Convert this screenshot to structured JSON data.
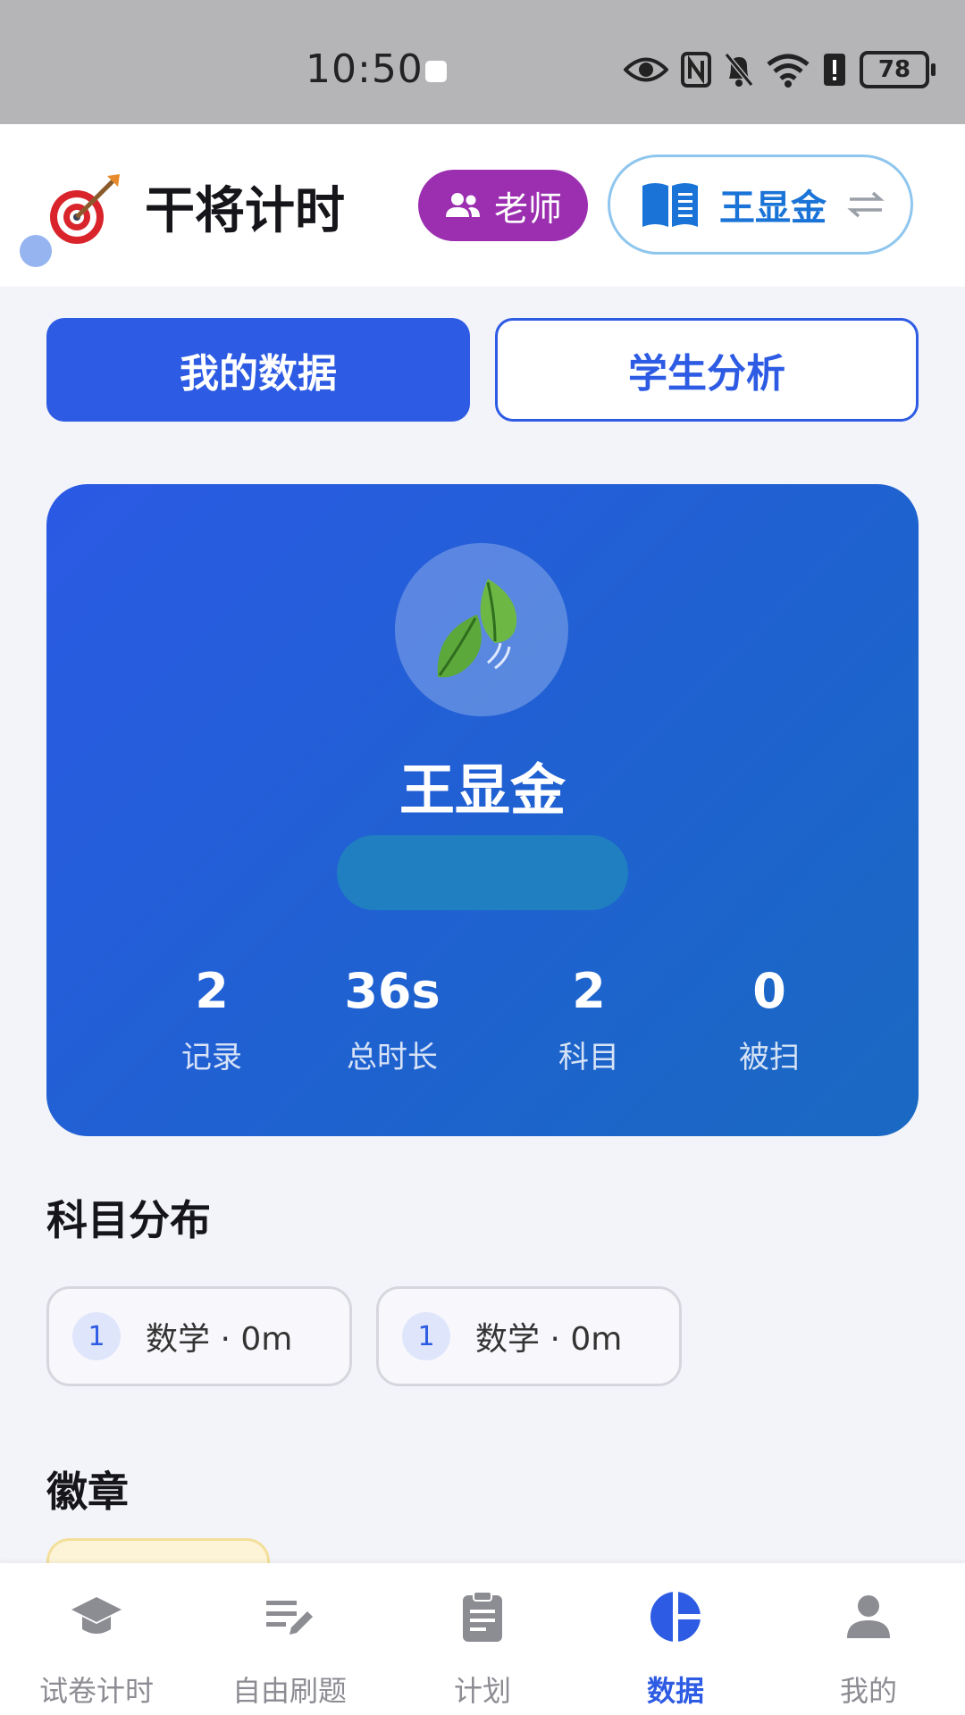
{
  "status_bar": {
    "time": "10:50",
    "battery": "78"
  },
  "header": {
    "app_title": "干将计时",
    "role_badge": "老师",
    "current_user": "王显金"
  },
  "tabs": [
    {
      "label": "我的数据",
      "active": true
    },
    {
      "label": "学生分析",
      "active": false
    }
  ],
  "profile": {
    "name": "王显金",
    "stats": [
      {
        "value": "2",
        "label": "记录"
      },
      {
        "value": "36s",
        "label": "总时长"
      },
      {
        "value": "2",
        "label": "科目"
      },
      {
        "value": "0",
        "label": "被扫"
      }
    ]
  },
  "subject_distribution": {
    "title": "科目分布",
    "items": [
      {
        "rank": "1",
        "text": "数学 · 0m"
      },
      {
        "rank": "1",
        "text": "数学 · 0m"
      }
    ]
  },
  "badges": {
    "title": "徽章"
  },
  "bottom_nav": [
    {
      "label": "试卷计时",
      "icon": "graduation-cap-icon",
      "active": false
    },
    {
      "label": "自由刷题",
      "icon": "edit-list-icon",
      "active": false
    },
    {
      "label": "计划",
      "icon": "clipboard-icon",
      "active": false
    },
    {
      "label": "数据",
      "icon": "pie-chart-icon",
      "active": true
    },
    {
      "label": "我的",
      "icon": "person-icon",
      "active": false
    }
  ],
  "colors": {
    "primary": "#2d5be3",
    "role_badge": "#9b2fb0",
    "user_switch_border": "#8fc6ee"
  }
}
